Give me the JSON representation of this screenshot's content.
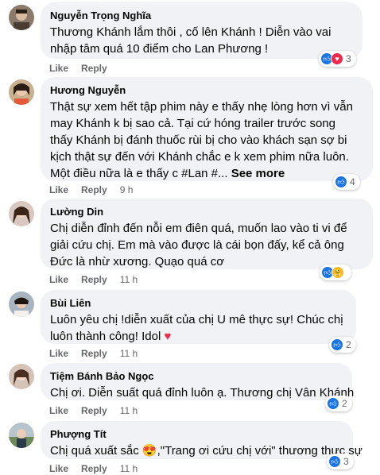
{
  "comments": [
    {
      "author": "Nguyễn Trọng Nghĩa",
      "lines": [
        "Thương Khánh lắm thôi , cố lên Khánh ! Diễn vào vai",
        "nhập tâm quá 10 điểm cho Lan Phương !"
      ],
      "like": "Like",
      "reply": "Reply",
      "time": "",
      "reactions": [
        "like",
        "love"
      ],
      "reaction_count": "3"
    },
    {
      "author": "Hương Nguyễn",
      "lines": [
        "Thật sự xem hết tập phim này e thấy nhẹ lòng hơn vì vẫn",
        "may Khánh k bị sao cả. Tại cứ hóng trailer trước song",
        "thấy Khánh bị đánh thuốc rùi bị cho vào khách sạn sợ bi",
        "kịch thật sự đến với Khánh chắc e k xem phim nữa luôn."
      ],
      "last_line": "Một điều nữa là e thấy c #Lan #...",
      "see_more": "See more",
      "like": "Like",
      "reply": "Reply",
      "time": "9 h",
      "reactions": [
        "like"
      ],
      "reaction_count": "4"
    },
    {
      "author": "Lường Din",
      "lines": [
        "Chị diễn đỉnh đến nỗi em điên quá, muốn lao vào ti vi để",
        "giải cứu chị. Em mà vào được là cái bọn đấy, kể cả ông",
        "Đức là nhừ xương. Quạo quá cơ"
      ],
      "like": "Like",
      "reply": "Reply",
      "time": "11 h",
      "reactions": [
        "like",
        "care"
      ],
      "reaction_count": ""
    },
    {
      "author": "Bùi Liên",
      "lines": [
        "Luôn yêu chị !diễn xuất của chị U mê thực sự! Chúc chị"
      ],
      "last_line": "luôn thành công! Idol",
      "heart": "♥",
      "like": "Like",
      "reply": "Reply",
      "time": "11 h",
      "reactions": [
        "like"
      ],
      "reaction_count": "2"
    },
    {
      "author": "Tiệm Bánh Bảo Ngọc",
      "lines": [
        "Chị ơi. Diễn suất quá đỉnh luôn ạ. Thương chị Vân Khánh"
      ],
      "like": "Like",
      "reply": "Reply",
      "time": "11 h",
      "reactions": [
        "like"
      ],
      "reaction_count": "2"
    },
    {
      "author": "Phượng Tít",
      "first_before": "Chị quá xuất sắc",
      "emoji": "😍",
      "first_after": ",\"Trang ơi cứu chị với\" thương thực sự",
      "like": "Like",
      "reply": "Reply",
      "time": "11 h",
      "reactions": [
        "like"
      ],
      "reaction_count": "3"
    }
  ],
  "colors": {
    "bubble": "#f0f2f5",
    "secondary_text": "#65676b",
    "like_blue": "#1b74e4",
    "love_red": "#f0284a"
  },
  "icons": {
    "like": "thumbs-up-icon",
    "love": "heart-icon",
    "care": "care-emoji-icon"
  }
}
